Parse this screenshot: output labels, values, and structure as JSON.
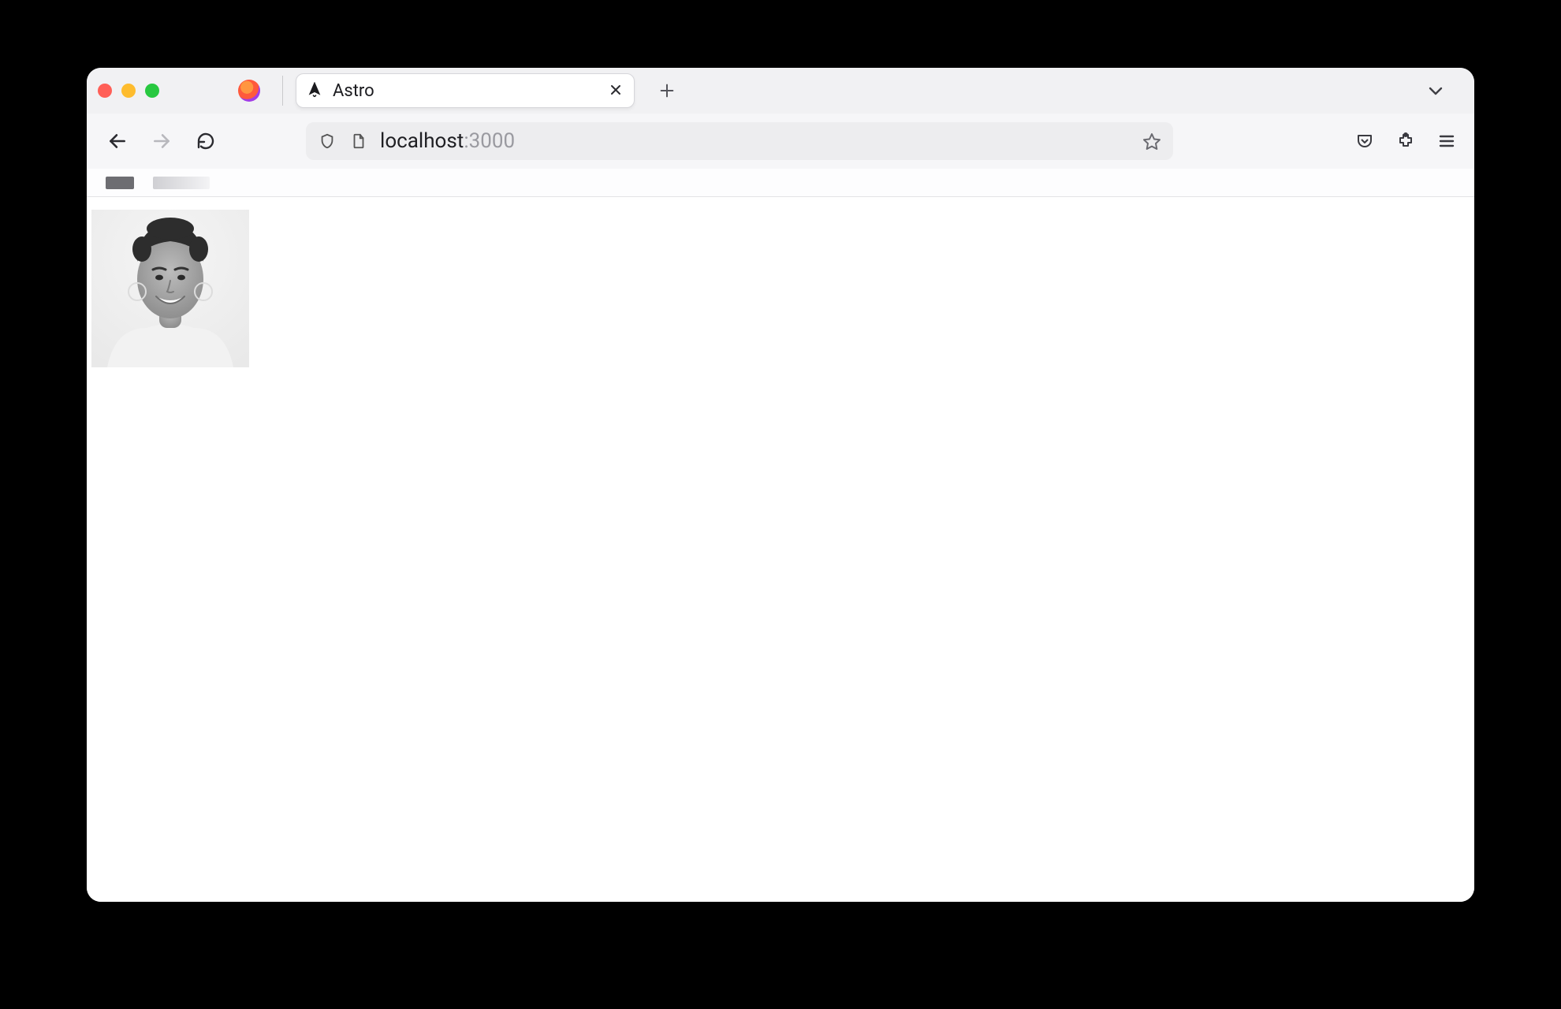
{
  "browser": {
    "tab": {
      "title": "Astro",
      "favicon_name": "astro-favicon"
    },
    "newtab_tooltip": "New Tab",
    "tablist_tooltip": "List all tabs"
  },
  "toolbar": {
    "back_tooltip": "Back",
    "forward_tooltip": "Forward",
    "reload_tooltip": "Reload",
    "shield_tooltip": "Tracking protection",
    "pageinfo_tooltip": "Site information",
    "bookmark_tooltip": "Bookmark this page",
    "pocket_tooltip": "Save to Pocket",
    "extensions_tooltip": "Extensions",
    "menu_tooltip": "Open application menu"
  },
  "url": {
    "host": "localhost",
    "port_suffix": ":3000"
  },
  "page": {
    "image_alt": "portrait-photo"
  }
}
